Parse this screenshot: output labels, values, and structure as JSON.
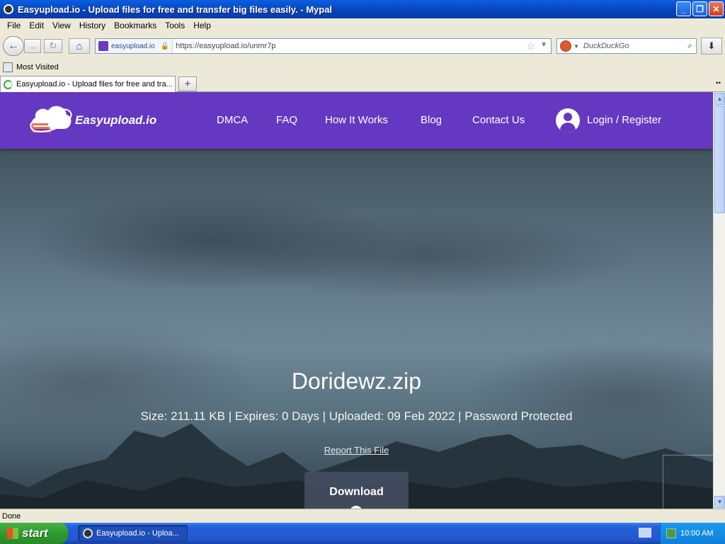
{
  "window": {
    "title": "Easyupload.io - Upload files for free and transfer big files easily. - Mypal",
    "buttons": {
      "minimize": "_",
      "maximize": "❐",
      "close": "✕"
    }
  },
  "menu": [
    "File",
    "Edit",
    "View",
    "History",
    "Bookmarks",
    "Tools",
    "Help"
  ],
  "toolbar": {
    "site_identity": "easyupload.io",
    "url": "https://easyupload.io/unmr7p",
    "search_placeholder": "DuckDuckGo"
  },
  "bookmarks": {
    "most_visited": "Most Visited"
  },
  "tabs": {
    "active_title": "Easyupload.io - Upload files for free and tra...",
    "new_tab": "+"
  },
  "site": {
    "logo_text": "Easyupload.io",
    "nav": [
      "DMCA",
      "FAQ",
      "How It Works",
      "Blog",
      "Contact Us"
    ],
    "login": "Login / Register",
    "brand_color": "#6438c0"
  },
  "file": {
    "name": "Doridewz.zip",
    "meta": "Size: 211.11 KB | Expires: 0 Days | Uploaded: 09 Feb 2022 | Password Protected",
    "report": "Report This File",
    "download": "Download"
  },
  "status": {
    "text": "Done"
  },
  "taskbar": {
    "start": "start",
    "task": "Easyupload.io - Uploa...",
    "clock": "10:00 AM"
  }
}
